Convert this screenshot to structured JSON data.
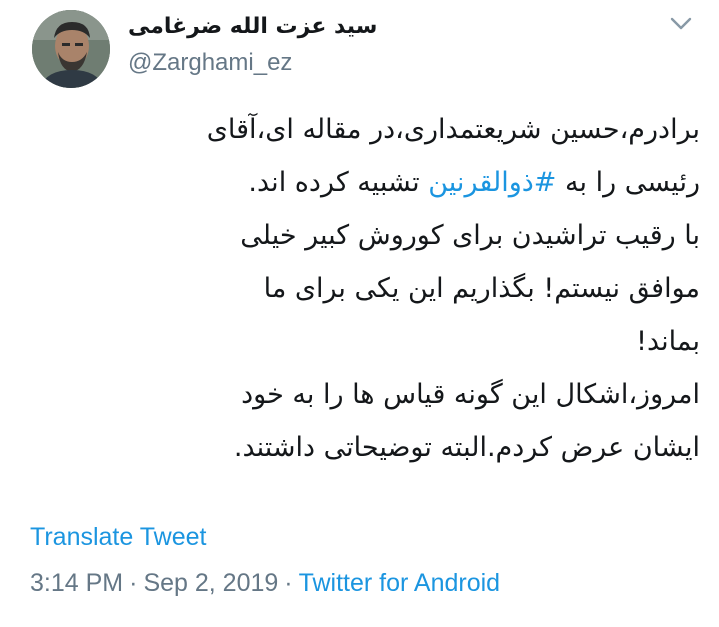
{
  "author": {
    "display_name": "سید عزت الله ضرغامی",
    "handle": "@Zarghami_ez"
  },
  "menu_icon": "chevron-down-icon",
  "tweet": {
    "lines": [
      {
        "text": "برادرم،حسین شریعتمداری،در مقاله ای،آقای"
      },
      {
        "before": "رئیسی را به ",
        "hashtag": "#ذوالقرنین",
        "after": " تشبیه کرده اند."
      },
      {
        "text": "با رقیب تراشیدن برای کوروش کبیر خیلی"
      },
      {
        "text": "موافق نیستم! بگذاریم این یکی برای ما"
      },
      {
        "text": "بماند!"
      },
      {
        "text": "امروز،اشکال این گونه قیاس ها را به خود"
      },
      {
        "text": "ایشان عرض کردم.البته توضیحاتی داشتند."
      }
    ]
  },
  "translate_label": "Translate Tweet",
  "meta": {
    "time": "3:14 PM",
    "separator": "·",
    "date": "Sep 2, 2019",
    "source": "Twitter for Android"
  },
  "colors": {
    "link": "#1b95e0",
    "secondary_text": "#657786",
    "primary_text": "#14171a"
  }
}
